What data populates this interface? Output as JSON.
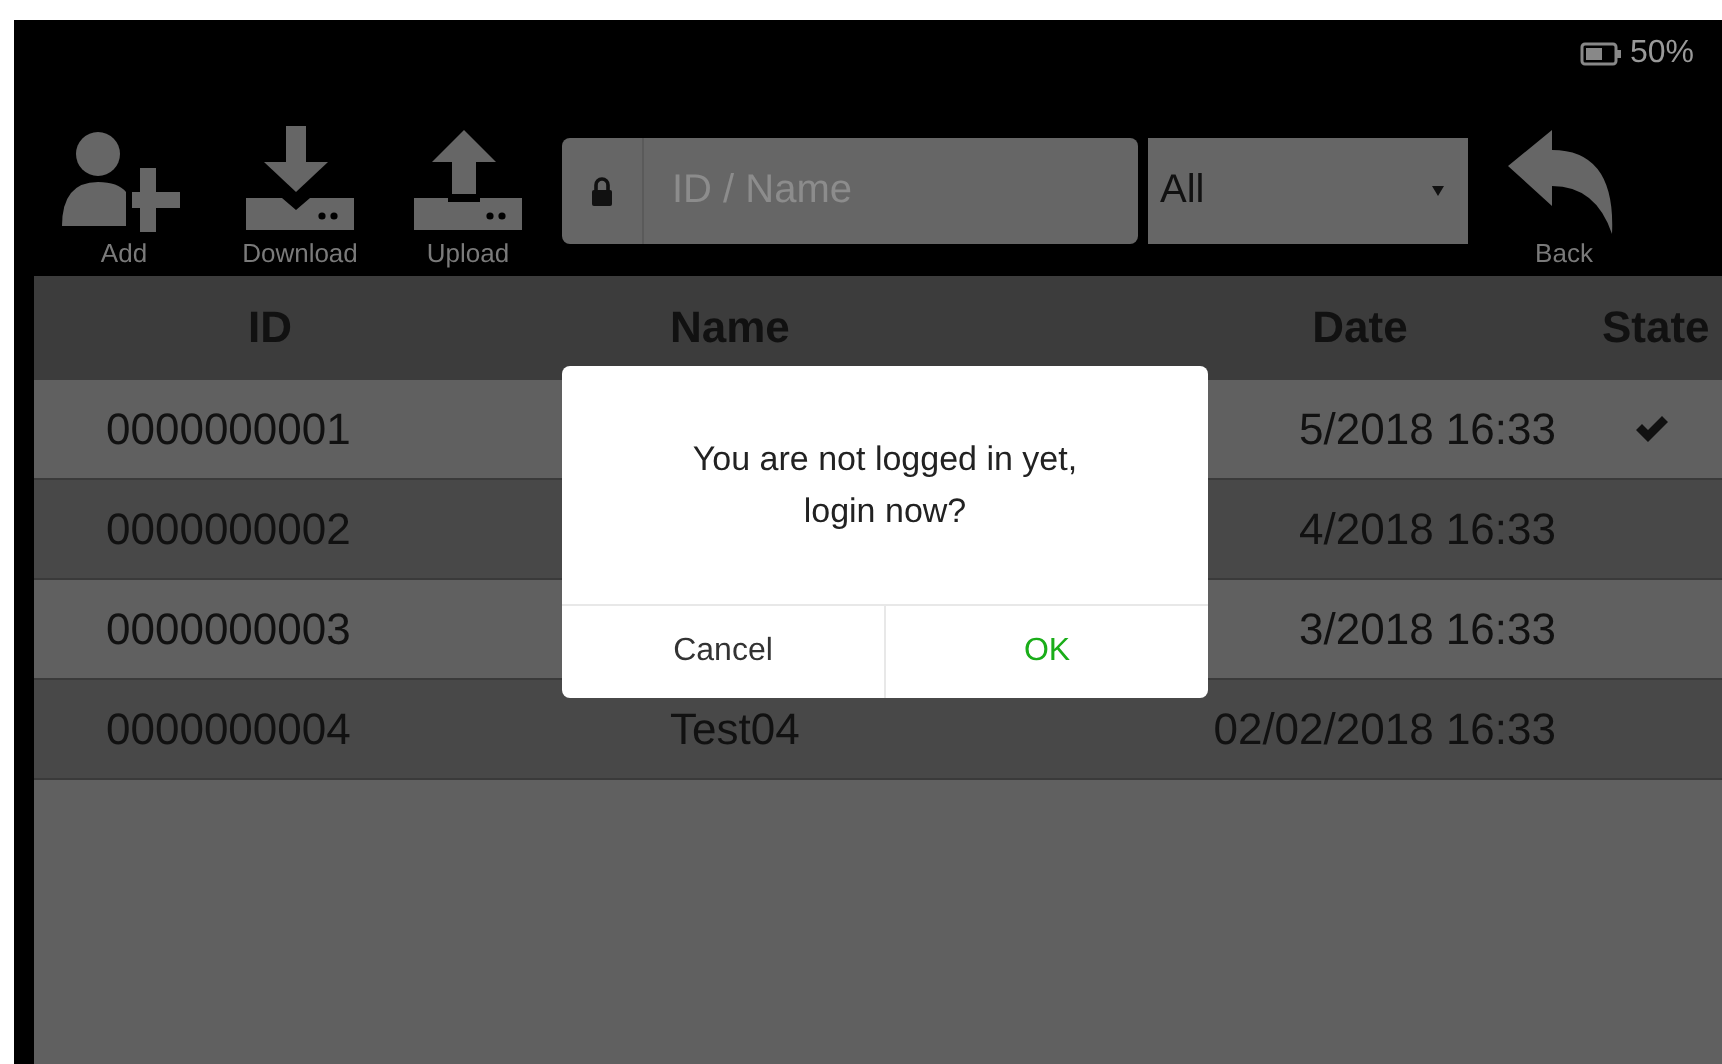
{
  "status": {
    "battery": "50%"
  },
  "toolbar": [
    {
      "label": "Add",
      "kind": "add"
    },
    {
      "label": "Download",
      "kind": "download"
    },
    {
      "label": "Upload",
      "kind": "upload"
    }
  ],
  "search": {
    "placeholder": "ID / Name"
  },
  "filter": {
    "value": "All"
  },
  "back": {
    "label": "Back"
  },
  "table": {
    "columns": [
      "ID",
      "Name",
      "Date",
      "State"
    ],
    "rows": [
      {
        "id": "0000000001",
        "date": "5/2018 16:33",
        "checked": true
      },
      {
        "id": "0000000002",
        "date": "4/2018 16:33",
        "checked": false
      },
      {
        "id": "0000000003",
        "date": "3/2018 16:33",
        "checked": false
      },
      {
        "id": "0000000004",
        "name": "Test04",
        "date": "02/02/2018 16:33",
        "checked": false
      }
    ]
  },
  "dialog": {
    "message": "You are not logged in yet,\nlogin now?",
    "buttons": [
      {
        "label": "Cancel",
        "kind": "cancel"
      },
      {
        "label": "OK",
        "kind": "confirm"
      }
    ]
  }
}
